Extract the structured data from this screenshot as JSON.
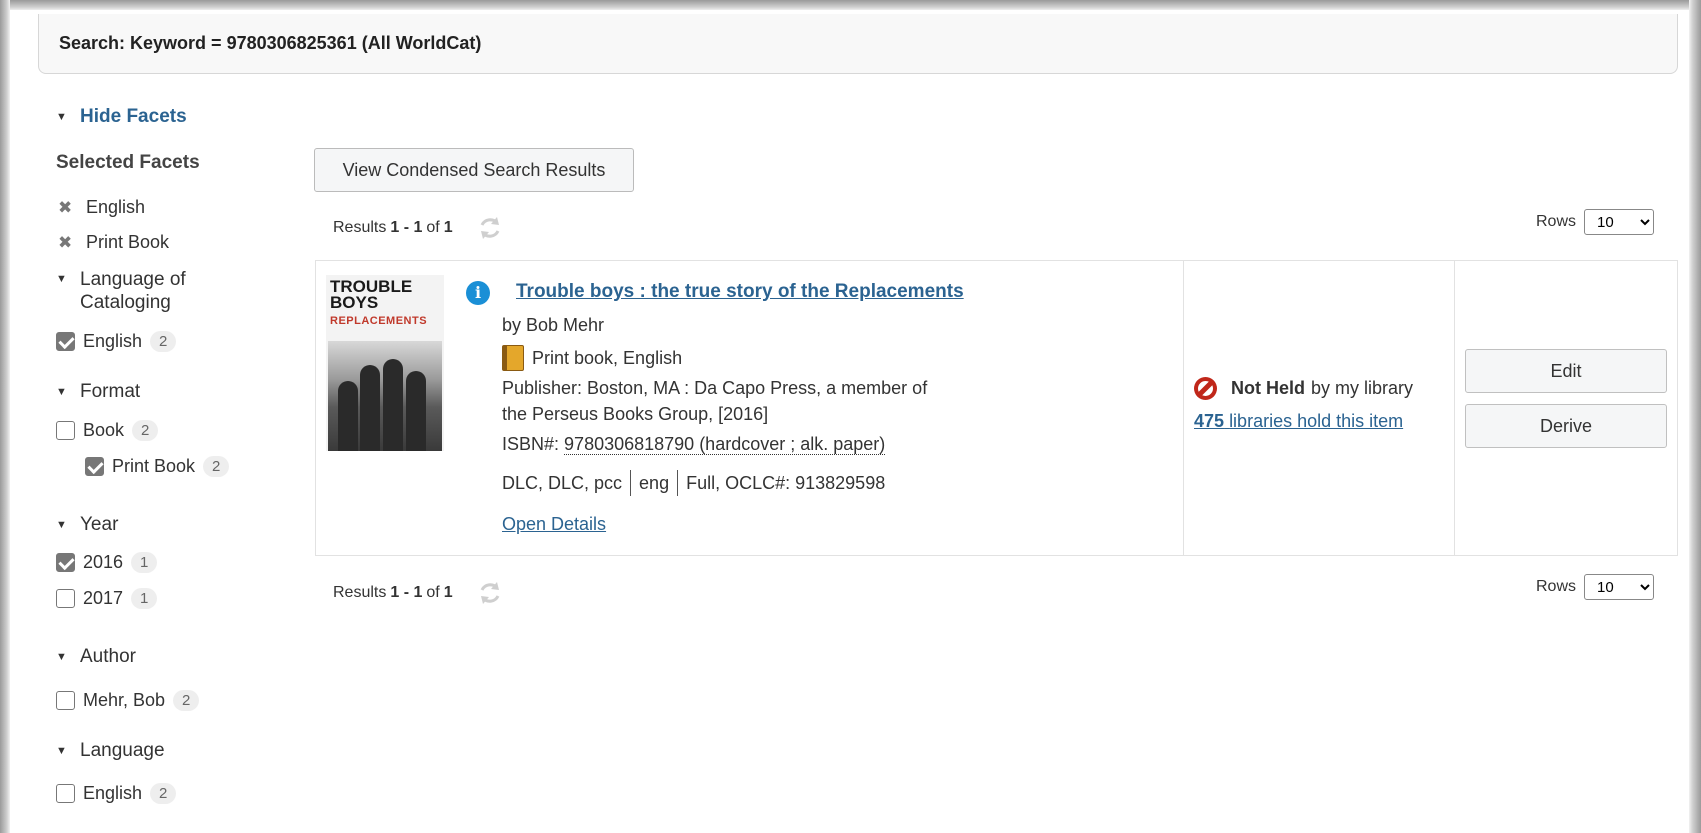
{
  "search": {
    "label": "Search: Keyword = 9780306825361 (All WorldCat)"
  },
  "facets": {
    "hide_label": "Hide Facets",
    "selected_heading": "Selected Facets",
    "selected": [
      {
        "label": "English"
      },
      {
        "label": "Print Book"
      }
    ],
    "groups": {
      "cataloging_lang": {
        "heading": "Language of Cataloging",
        "items": [
          {
            "label": "English",
            "count": "2",
            "checked": true
          }
        ]
      },
      "format": {
        "heading": "Format",
        "items": [
          {
            "label": "Book",
            "count": "2",
            "checked": false
          },
          {
            "label": "Print Book",
            "count": "2",
            "checked": true
          }
        ]
      },
      "year": {
        "heading": "Year",
        "items": [
          {
            "label": "2016",
            "count": "1",
            "checked": true
          },
          {
            "label": "2017",
            "count": "1",
            "checked": false
          }
        ]
      },
      "author": {
        "heading": "Author",
        "items": [
          {
            "label": "Mehr, Bob",
            "count": "2",
            "checked": false
          }
        ]
      },
      "language": {
        "heading": "Language",
        "items": [
          {
            "label": "English",
            "count": "2",
            "checked": false
          }
        ]
      }
    }
  },
  "main": {
    "condensed_button": "View Condensed Search Results",
    "results_prefix": "Results",
    "results_range": "1 - 1",
    "results_of": "of",
    "results_total": "1",
    "rows_label": "Rows",
    "rows_value": "10"
  },
  "record": {
    "cover_title": "TROUBLE BOYS",
    "cover_subtitle": "REPLACEMENTS",
    "title": "Trouble boys : the true story of the Replacements",
    "by": "by Bob Mehr",
    "format": "Print book, English",
    "publisher": "Publisher: Boston, MA : Da Capo Press, a member of the Perseus Books Group, [2016]",
    "isbn_label": "ISBN#:",
    "isbn_value": "9780306818790 (hardcover ; alk. paper)",
    "meta_source": "DLC, DLC, pcc",
    "meta_lang": "eng",
    "meta_level": "Full, OCLC#: 913829598",
    "open_details": "Open Details",
    "held_status": "Not Held",
    "held_suffix": "by my library",
    "libs_count": "475",
    "libs_text": "libraries hold this item",
    "edit_label": "Edit",
    "derive_label": "Derive"
  },
  "colors": {
    "link": "#2b6391",
    "info": "#1a8fd6",
    "not_held": "#c0271a"
  }
}
